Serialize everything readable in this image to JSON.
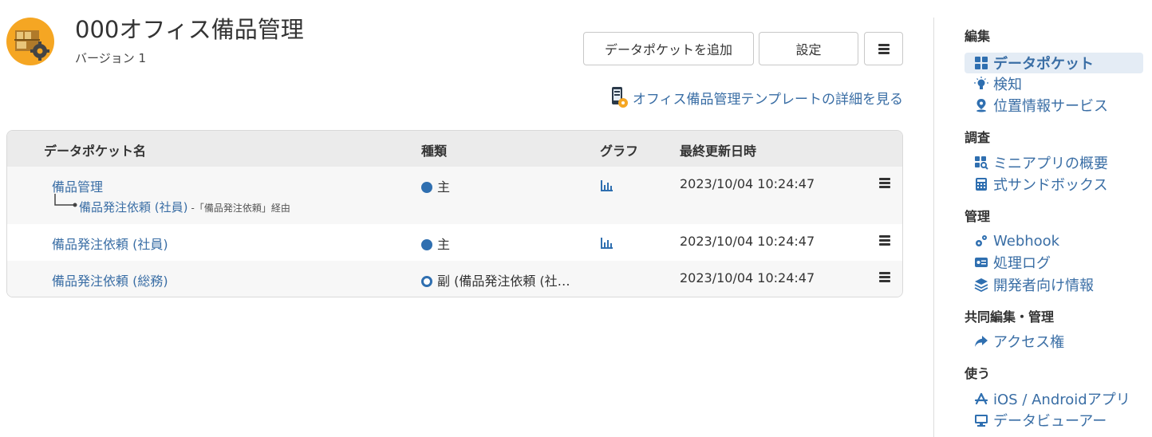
{
  "header": {
    "title": "000オフィス備品管理",
    "version": "バージョン 1",
    "app_icon": "office-supplies-gear-icon"
  },
  "toolbar": {
    "add_label": "データポケットを追加",
    "settings_label": "設定",
    "menu_icon": "hamburger-icon"
  },
  "template_link": {
    "label": "オフィス備品管理テンプレートの詳細を見る",
    "icon": "mobile-template-icon"
  },
  "table": {
    "columns": [
      "データポケット名",
      "種類",
      "グラフ",
      "最終更新日時"
    ],
    "rows": [
      {
        "name": "備品管理",
        "sub_name": "備品発注依頼 (社員)",
        "sub_via": "-「備品発注依頼」経由",
        "type": "主",
        "type_kind": "primary",
        "has_chart": true,
        "updated": "2023/10/04 10:24:47"
      },
      {
        "name": "備品発注依頼 (社員)",
        "type": "主",
        "type_kind": "primary",
        "has_chart": true,
        "updated": "2023/10/04 10:24:47"
      },
      {
        "name": "備品発注依頼 (総務)",
        "type": "副 (備品発注依頼 (社…",
        "type_kind": "secondary",
        "has_chart": false,
        "updated": "2023/10/04 10:24:47"
      }
    ]
  },
  "sidebar": {
    "sections": [
      {
        "heading": "編集",
        "items": [
          {
            "label": "データポケット",
            "icon": "grid-icon",
            "active": true
          },
          {
            "label": "検知",
            "icon": "lightbulb-icon"
          },
          {
            "label": "位置情報サービス",
            "icon": "map-pin-icon"
          }
        ]
      },
      {
        "heading": "調査",
        "items": [
          {
            "label": "ミニアプリの概要",
            "icon": "grid-search-icon"
          },
          {
            "label": "式サンドボックス",
            "icon": "calculator-icon"
          }
        ]
      },
      {
        "heading": "管理",
        "items": [
          {
            "label": "Webhook",
            "icon": "gears-icon"
          },
          {
            "label": "処理ログ",
            "icon": "log-card-icon"
          },
          {
            "label": "開発者向け情報",
            "icon": "layers-icon"
          }
        ]
      },
      {
        "heading": "共同編集・管理",
        "items": [
          {
            "label": "アクセス権",
            "icon": "share-arrow-icon"
          }
        ]
      },
      {
        "heading": "使う",
        "items": [
          {
            "label": "iOS / Androidアプリ",
            "icon": "app-store-icon"
          },
          {
            "label": "データビューアー",
            "icon": "monitor-icon"
          }
        ]
      }
    ]
  },
  "colors": {
    "link": "#3a6ea5",
    "accent": "#2f6fb0",
    "header_bg": "#ebebeb",
    "app_icon_bg": "#f5a623"
  }
}
